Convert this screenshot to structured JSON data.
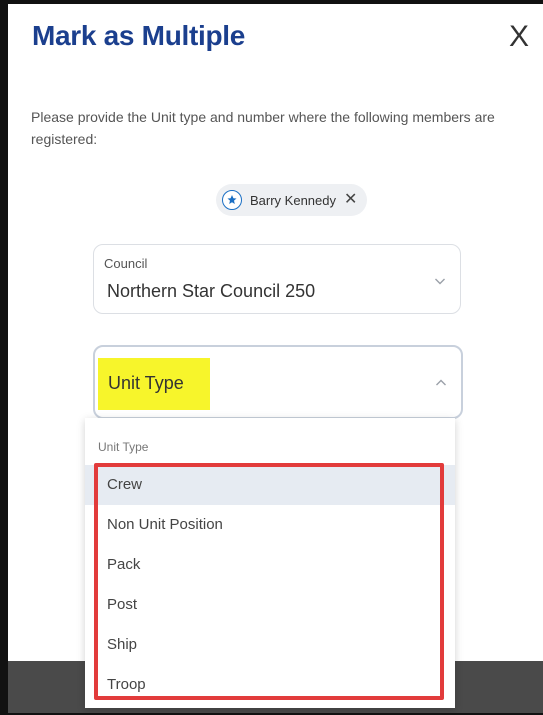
{
  "modal": {
    "title": "Mark as Multiple",
    "close_symbol": "X",
    "instructions": "Please provide the Unit type and number where the following members are registered:"
  },
  "member_chip": {
    "name": "Barry Kennedy",
    "icon": "scout-emblem-icon",
    "remove_symbol": "✕"
  },
  "council_field": {
    "label": "Council",
    "value": "Northern Star Council 250",
    "icon": "chevron-down-icon"
  },
  "unit_type_field": {
    "placeholder": "Unit Type",
    "icon": "chevron-up-icon",
    "highlight_color": "#f7f52b"
  },
  "unit_type_dropdown": {
    "header": "Unit Type",
    "options": [
      "Crew",
      "Non Unit Position",
      "Pack",
      "Post",
      "Ship",
      "Troop"
    ],
    "active_index": 0
  },
  "colors": {
    "title": "#1b3f8e",
    "annotation_outline": "#e23b3b",
    "active_option_bg": "#e6ebf2"
  }
}
